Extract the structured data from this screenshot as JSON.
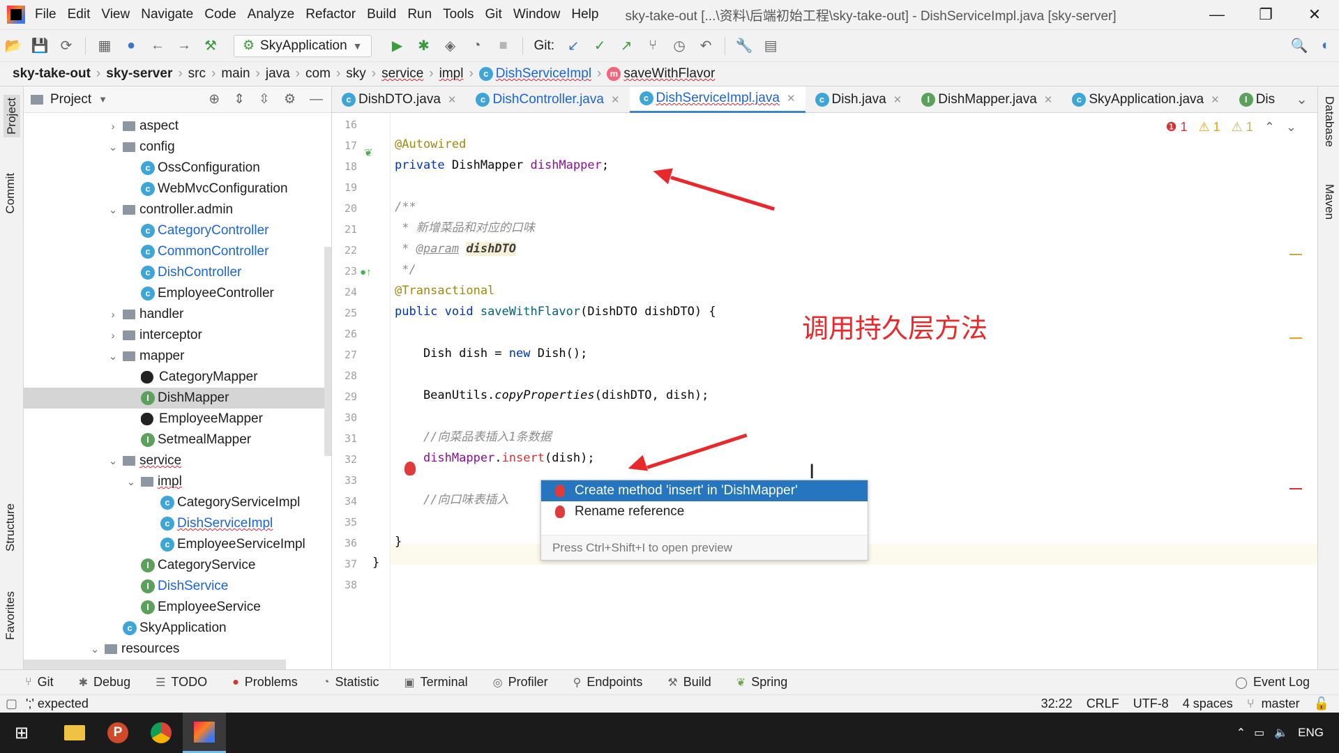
{
  "menu": [
    "File",
    "Edit",
    "View",
    "Navigate",
    "Code",
    "Analyze",
    "Refactor",
    "Build",
    "Run",
    "Tools",
    "Git",
    "Window",
    "Help"
  ],
  "window_title": "sky-take-out [...\\资料\\后端初始工程\\sky-take-out] - DishServiceImpl.java [sky-server]",
  "toolbar": {
    "run_config": "SkyApplication",
    "git_label": "Git:"
  },
  "breadcrumbs": [
    "sky-take-out",
    "sky-server",
    "src",
    "main",
    "java",
    "com",
    "sky",
    "service",
    "impl",
    "DishServiceImpl",
    "saveWithFlavor"
  ],
  "project_panel": {
    "title": "Project"
  },
  "tree": [
    {
      "label": "aspect",
      "type": "folder",
      "depth": 1,
      "chev": "›"
    },
    {
      "label": "config",
      "type": "folder",
      "depth": 1,
      "chev": "⌄"
    },
    {
      "label": "OssConfiguration",
      "type": "class",
      "depth": 2
    },
    {
      "label": "WebMvcConfiguration",
      "type": "class",
      "depth": 2
    },
    {
      "label": "controller.admin",
      "type": "folder",
      "depth": 1,
      "chev": "⌄"
    },
    {
      "label": "CategoryController",
      "type": "class",
      "depth": 2,
      "blue": true
    },
    {
      "label": "CommonController",
      "type": "class",
      "depth": 2,
      "blue": true
    },
    {
      "label": "DishController",
      "type": "class",
      "depth": 2,
      "blue": true
    },
    {
      "label": "EmployeeController",
      "type": "class",
      "depth": 2
    },
    {
      "label": "handler",
      "type": "folder",
      "depth": 1,
      "chev": "›"
    },
    {
      "label": "interceptor",
      "type": "folder",
      "depth": 1,
      "chev": "›"
    },
    {
      "label": "mapper",
      "type": "folder",
      "depth": 1,
      "chev": "⌄"
    },
    {
      "label": "CategoryMapper",
      "type": "mybatis",
      "depth": 2
    },
    {
      "label": "DishMapper",
      "type": "interface",
      "depth": 2,
      "selected": true
    },
    {
      "label": "EmployeeMapper",
      "type": "mybatis",
      "depth": 2
    },
    {
      "label": "SetmealMapper",
      "type": "interface",
      "depth": 2
    },
    {
      "label": "service",
      "type": "folder",
      "depth": 1,
      "chev": "⌄",
      "wavy": true
    },
    {
      "label": "impl",
      "type": "folder",
      "depth": 2,
      "chev": "⌄",
      "wavy": true
    },
    {
      "label": "CategoryServiceImpl",
      "type": "class",
      "depth": 3
    },
    {
      "label": "DishServiceImpl",
      "type": "class",
      "depth": 3,
      "blue": true,
      "wavy": true
    },
    {
      "label": "EmployeeServiceImpl",
      "type": "class",
      "depth": 3
    },
    {
      "label": "CategoryService",
      "type": "interface",
      "depth": 2
    },
    {
      "label": "DishService",
      "type": "interface",
      "depth": 2,
      "blue": true
    },
    {
      "label": "EmployeeService",
      "type": "interface",
      "depth": 2
    },
    {
      "label": "SkyApplication",
      "type": "class",
      "depth": 1
    },
    {
      "label": "resources",
      "type": "folder",
      "depth": 0,
      "chev": "⌄"
    }
  ],
  "editor_tabs": [
    {
      "label": "DishDTO.java",
      "icon": "class"
    },
    {
      "label": "DishController.java",
      "icon": "class",
      "blue": true
    },
    {
      "label": "DishServiceImpl.java",
      "icon": "class",
      "blue": true,
      "active": true
    },
    {
      "label": "Dish.java",
      "icon": "class"
    },
    {
      "label": "DishMapper.java",
      "icon": "interface"
    },
    {
      "label": "SkyApplication.java",
      "icon": "class"
    },
    {
      "label": "Dis",
      "icon": "interface",
      "truncated": true
    }
  ],
  "inspection": {
    "errors": "1",
    "warnings": "1",
    "weak": "1"
  },
  "line_numbers": [
    "16",
    "17",
    "18",
    "19",
    "20",
    "21",
    "22",
    "23",
    "24",
    "25",
    "26",
    "27",
    "28",
    "29",
    "30",
    "31",
    "32",
    "33",
    "34",
    "35",
    "36",
    "37",
    "38"
  ],
  "code_lines": {
    "l17": "@Autowired",
    "l18a": "private ",
    "l18b": "DishMapper ",
    "l18c": "dishMapper",
    "l18d": ";",
    "l20": "/**",
    "l21": " * 新增菜品和对应的口味",
    "l22a": " * ",
    "l22b": "@param",
    "l22c": " ",
    "l22d": "dishDTO",
    "l23": " */",
    "l24": "@Transactional",
    "l25a": "public void ",
    "l25b": "saveWithFlavor",
    "l25c": "(DishDTO dishDTO) {",
    "l27a": "    Dish dish = ",
    "l27b": "new ",
    "l27c": "Dish();",
    "l29a": "    BeanUtils.",
    "l29b": "copyProperties",
    "l29c": "(dishDTO, dish);",
    "l31": "    //向菜品表插入1条数据",
    "l32a": "    ",
    "l32b": "dishMapper",
    "l32c": ".",
    "l32d": "insert",
    "l32e": "(dish);",
    "l34": "    //向口味表插入",
    "l36": "}",
    "l37": "}"
  },
  "annotation_note": "调用持久层方法",
  "popup": {
    "items": [
      "Create method 'insert' in 'DishMapper'",
      "Rename reference"
    ],
    "hint": "Press Ctrl+Shift+I to open preview"
  },
  "bottom_tabs": [
    "Git",
    "Debug",
    "TODO",
    "Problems",
    "Statistic",
    "Terminal",
    "Profiler",
    "Endpoints",
    "Build",
    "Spring"
  ],
  "event_log": "Event Log",
  "status": {
    "message": "';' expected",
    "position": "32:22",
    "line_sep": "CRLF",
    "encoding": "UTF-8",
    "indent": "4 spaces",
    "branch": "master"
  },
  "side_tabs": {
    "left": [
      "Project",
      "Commit",
      "Structure",
      "Favorites"
    ],
    "right": [
      "Database",
      "Maven"
    ]
  },
  "taskbar_lang": "ENG",
  "colors": {
    "accent": "#2675bf",
    "error": "#d53232",
    "annotation": "#e8282a"
  }
}
